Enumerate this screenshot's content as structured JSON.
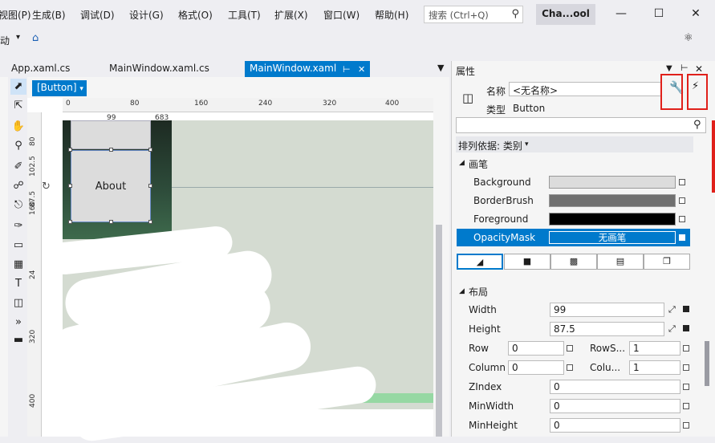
{
  "menu": {
    "items": [
      "视图(P)",
      "生成(B)",
      "调试(D)",
      "设计(G)",
      "格式(O)",
      "工具(T)",
      "扩展(X)",
      "窗口(W)",
      "帮助(H)"
    ],
    "search_placeholder": "搜索 (Ctrl+Q)",
    "app_title": "Cha...ool"
  },
  "toolbar": {
    "item": "动"
  },
  "tabs": [
    "App.xaml.cs",
    "MainWindow.xaml.cs",
    "MainWindow.xaml"
  ],
  "designer": {
    "element_label": "[Button]",
    "about_text": "About",
    "ruler_h": [
      "0",
      "80",
      "160",
      "240",
      "320",
      "400"
    ],
    "ruler_v": [
      "80",
      "102.5",
      "87.5",
      "160",
      "24",
      "320",
      "400"
    ],
    "dim_top": "99",
    "dim_right": "683"
  },
  "props": {
    "title": "属性",
    "name_label": "名称",
    "name_value": "<无名称>",
    "type_label": "类型",
    "type_value": "Button",
    "sort_label": "排列依据: 类别",
    "brush_section": "画笔",
    "brushes": [
      {
        "name": "Background",
        "color": "#dcdcdc"
      },
      {
        "name": "BorderBrush",
        "color": "#707070"
      },
      {
        "name": "Foreground",
        "color": "#000000"
      },
      {
        "name": "OpacityMask",
        "value": "无画笔"
      }
    ],
    "layout_section": "布局",
    "layout": {
      "width_label": "Width",
      "width": "99",
      "height_label": "Height",
      "height": "87.5",
      "row_label": "Row",
      "row": "0",
      "rowspan_label": "RowS...",
      "rowspan": "1",
      "column_label": "Column",
      "column": "0",
      "colspan_label": "Colu...",
      "colspan": "1",
      "zindex_label": "ZIndex",
      "zindex": "0",
      "minwidth_label": "MinWidth",
      "minwidth": "0",
      "minheight_label": "MinHeight",
      "minheight": "0"
    }
  },
  "colors": {
    "accent": "#007acc",
    "highlight": "#e0201a"
  }
}
